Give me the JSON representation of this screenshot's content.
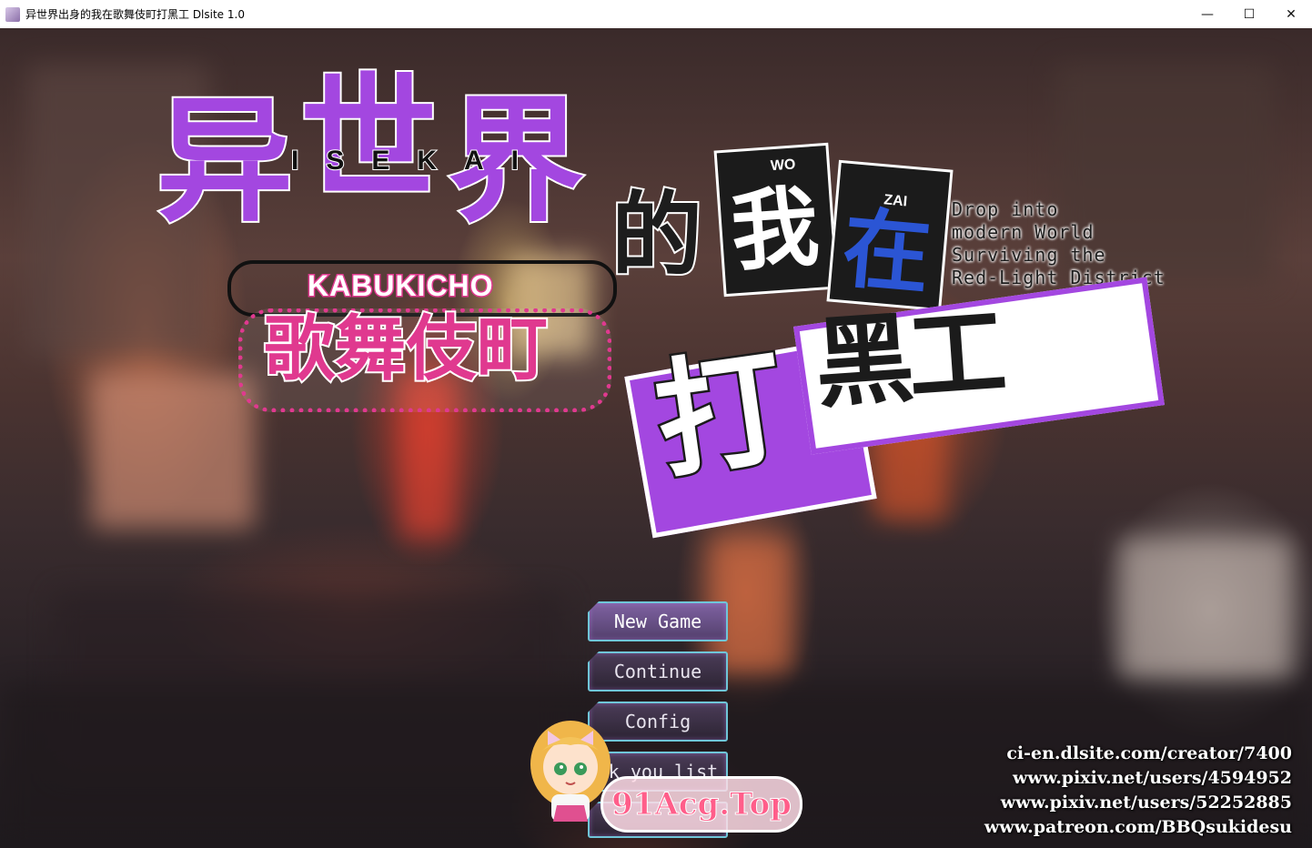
{
  "window": {
    "title": "异世界出身的我在歌舞伎町打黑工 Dlsite 1.0",
    "minimize": "—",
    "maximize": "☐",
    "close": "✕"
  },
  "logo": {
    "isekai_cn": [
      "异",
      "世",
      "界"
    ],
    "isekai_roman": "ISEKAI",
    "kabukicho_roman": "KABUKICHO",
    "kabukicho_cn": "歌舞伎町",
    "de": "的",
    "wo_roman": "WO",
    "wo_cn": "我",
    "zai_roman": "ZAI",
    "zai_cn": "在",
    "da": "打",
    "heigong": "黑工",
    "tagline": [
      "Drop into",
      "modern World",
      "Surviving the",
      "Red-Light District"
    ]
  },
  "menu": {
    "items": [
      {
        "label": "New Game",
        "selected": true
      },
      {
        "label": "Continue"
      },
      {
        "label": "Config"
      },
      {
        "label": "nk you list"
      },
      {
        "label": ""
      }
    ]
  },
  "credits": [
    "ci-en.dlsite.com/creator/7400",
    "www.pixiv.net/users/4594952",
    "www.pixiv.net/users/52252885",
    "www.patreon.com/BBQsukidesu"
  ],
  "watermark": {
    "text": "91Acg.Top"
  },
  "colors": {
    "purple": "#a347e0",
    "pink": "#e0398f",
    "blue_accent": "#2b55d4",
    "menu_border": "#6fc6d8"
  }
}
